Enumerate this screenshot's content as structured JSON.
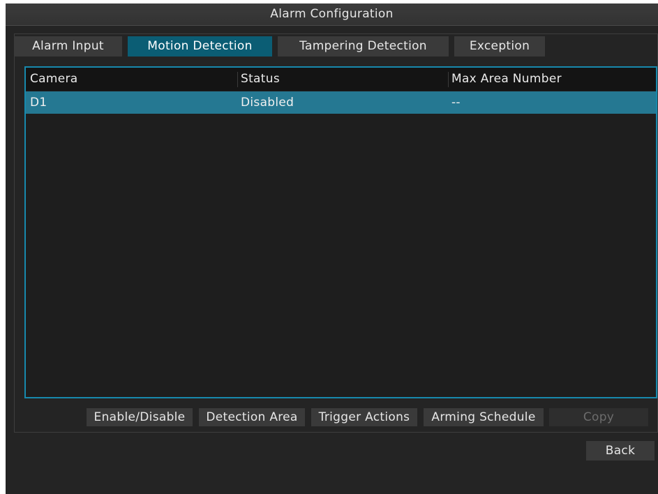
{
  "window": {
    "title": "Alarm Configuration"
  },
  "tabs": [
    {
      "label": "Alarm Input",
      "active": false
    },
    {
      "label": "Motion Detection",
      "active": true
    },
    {
      "label": "Tampering Detection",
      "active": false
    },
    {
      "label": "Exception",
      "active": false
    }
  ],
  "table": {
    "columns": [
      "Camera",
      "Status",
      "Max Area Number"
    ],
    "rows": [
      {
        "camera": "D1",
        "status": "Disabled",
        "max_area": "--",
        "selected": true
      }
    ]
  },
  "actions": {
    "enable_disable": "Enable/Disable",
    "detection_area": "Detection Area",
    "trigger_actions": "Trigger Actions",
    "arming_schedule": "Arming Schedule",
    "copy": "Copy",
    "copy_enabled": false
  },
  "footer": {
    "back": "Back"
  },
  "colors": {
    "background": "#242424",
    "active_tab": "#0b5d74",
    "selected_row": "#257892",
    "table_border": "#1789ad"
  }
}
